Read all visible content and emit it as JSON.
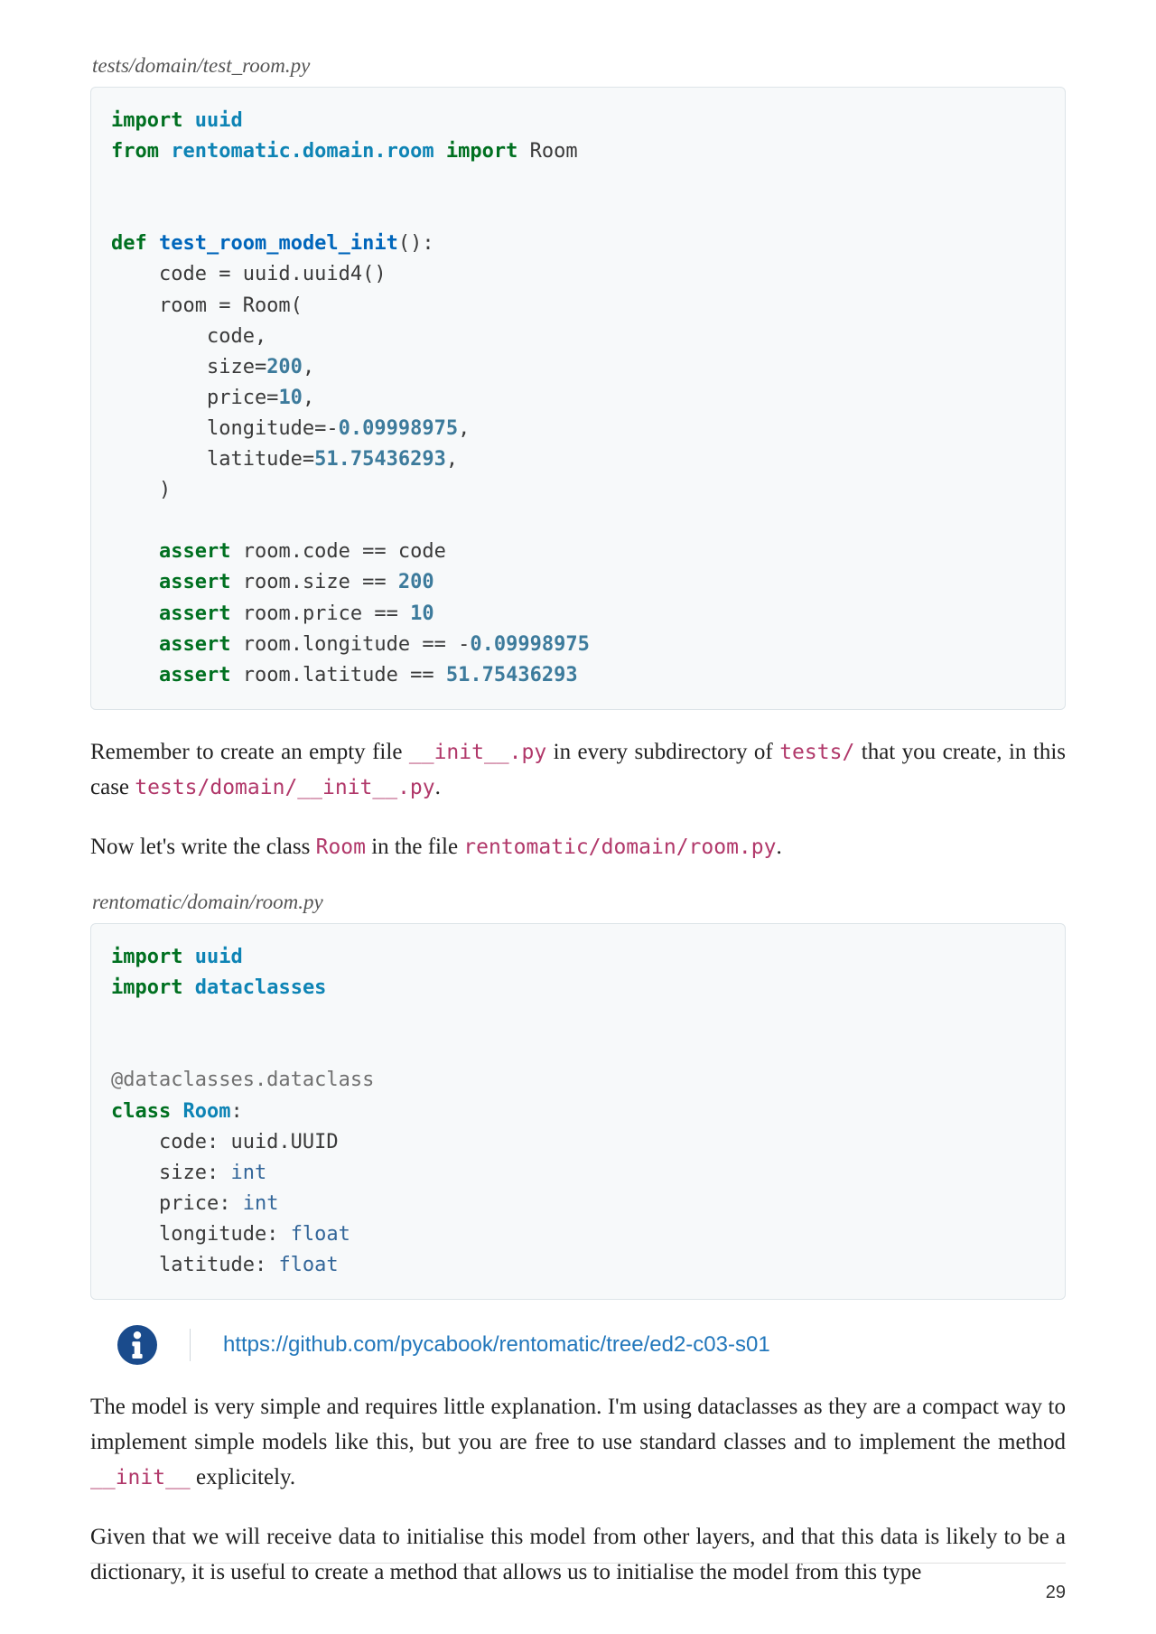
{
  "captions": {
    "code1": "tests/domain/test_room.py",
    "code2": "rentomatic/domain/room.py"
  },
  "code1": {
    "l01_import": "import",
    "l01_uuid": "uuid",
    "l02_from": "from",
    "l02_module": "rentomatic.domain.room",
    "l02_import": "import",
    "l02_room": "Room",
    "l04_def": "def",
    "l04_name": "test_room_model_init",
    "l04_paren": "():",
    "l05": "    code = uuid.uuid4()",
    "l06": "    room = Room(",
    "l07": "        code,",
    "l08a": "        size=",
    "l08b": "200",
    "l08c": ",",
    "l09a": "        price=",
    "l09b": "10",
    "l09c": ",",
    "l10a": "        longitude=-",
    "l10b": "0.09998975",
    "l10c": ",",
    "l11a": "        latitude=",
    "l11b": "51.75436293",
    "l11c": ",",
    "l12": "    )",
    "l14_assert": "assert",
    "l14_rest": " room.code == code",
    "l15_assert": "assert",
    "l15_rest": " room.size == ",
    "l15_num": "200",
    "l16_assert": "assert",
    "l16_rest": " room.price == ",
    "l16_num": "10",
    "l17_assert": "assert",
    "l17_rest": " room.longitude == -",
    "l17_num": "0.09998975",
    "l18_assert": "assert",
    "l18_rest": " room.latitude == ",
    "l18_num": "51.75436293"
  },
  "para1": {
    "t1": "Remember to create an empty file ",
    "c1": "__init__.py",
    "t2": " in every subdirectory of ",
    "c2": "tests/",
    "t3": " that you create, in this case ",
    "c3": "tests/domain/__init__.py",
    "t4": "."
  },
  "para2": {
    "t1": "Now let's write the class ",
    "c1": "Room",
    "t2": " in the file ",
    "c2": "rentomatic/domain/room.py",
    "t3": "."
  },
  "code2": {
    "l01_import": "import",
    "l01_uuid": "uuid",
    "l02_import": "import",
    "l02_dc": "dataclasses",
    "l04_dec": "@dataclasses.dataclass",
    "l05_class": "class",
    "l05_room": "Room",
    "l05_colon": ":",
    "l06": "    code: uuid.UUID",
    "l07a": "    size: ",
    "l07b": "int",
    "l08a": "    price: ",
    "l08b": "int",
    "l09a": "    longitude: ",
    "l09b": "float",
    "l10a": "    latitude: ",
    "l10b": "float"
  },
  "info": {
    "url": "https://github.com/pycabook/rentomatic/tree/ed2-c03-s01"
  },
  "para3": {
    "t1": "The model is very simple and requires little explanation. I'm using dataclasses as they are a compact way to implement simple models like this, but you are free to use standard classes and to implement the method ",
    "c1": "__init__",
    "t2": " explicitely."
  },
  "para4": {
    "t1": "Given that we will receive data to initialise this model from other layers, and that this data is likely to be a dictionary, it is useful to create a method that allows us to initialise the model from this type"
  },
  "page_number": "29"
}
